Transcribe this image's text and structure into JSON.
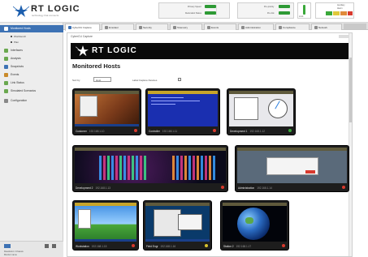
{
  "brand": {
    "name": "RT LOGIC",
    "tagline": "technology that connects"
  },
  "header": {
    "status_labels": [
      "Primary Speed",
      "Redundant Status"
    ],
    "warning_labels": [
      "Pre-priority",
      "Pre-link"
    ],
    "alarm_labels": [
      "Limit",
      "Auxiliary",
      "Alarm"
    ]
  },
  "sidebar": {
    "items": [
      {
        "label": "Monitored Hosts",
        "icon": "monitor-icon"
      },
      {
        "label": "Workbench",
        "sub": true
      },
      {
        "label": "Plan",
        "sub": true
      },
      {
        "label": "Interfaces",
        "icon": "plug-icon"
      },
      {
        "label": "Analysis",
        "icon": "chart-icon"
      },
      {
        "label": "Snapshots",
        "icon": "camera-icon"
      },
      {
        "label": "Events",
        "icon": "bell-icon"
      },
      {
        "label": "Link Status",
        "icon": "link-icon"
      },
      {
        "label": "Simulated Scenarios",
        "icon": "flask-icon"
      },
      {
        "label": "Configuration",
        "icon": "gear-icon"
      }
    ],
    "footer_text": [
      "Resolution / Chassis",
      "Monitor name"
    ]
  },
  "tabs": [
    {
      "label": "CyberCU Capture",
      "active": true
    },
    {
      "label": "Emulator"
    },
    {
      "label": "Security"
    },
    {
      "label": "Telemetry"
    },
    {
      "label": "Events"
    },
    {
      "label": "Administration"
    },
    {
      "label": "Compliance"
    },
    {
      "label": "Network"
    }
  ],
  "main": {
    "window_title": "CyberCU Capture",
    "page_title": "Monitored Hosts",
    "sort_label": "Sort by",
    "sort_value": "Host",
    "checkbox_label": "Label Capture Devices"
  },
  "hosts": [
    {
      "name": "Customer",
      "ip": "192.168.1.10",
      "status_color": "#d83a2e",
      "theme": "xp-warm"
    },
    {
      "name": "Controller",
      "ip": "192.168.1.11",
      "status_color": "#d83a2e",
      "theme": "blue-text"
    },
    {
      "name": "Development 1",
      "ip": "192.168.1.12",
      "status_color": "#3aa83a",
      "theme": "diagram"
    },
    {
      "name": "Development 2",
      "ip": "192.168.1.13",
      "status_color": "#d83a2e",
      "theme": "bars"
    },
    {
      "name": "Administration",
      "ip": "192.168.1.14",
      "status_color": "#d83a2e",
      "theme": "dialog"
    },
    {
      "name": "Workstation",
      "ip": "192.168.1.15",
      "status_color": "#d83a2e",
      "theme": "xp-bliss"
    },
    {
      "name": "Field Engr",
      "ip": "192.168.1.16",
      "status_color": "#d8c22e",
      "theme": "menus"
    },
    {
      "name": "Station 2",
      "ip": "192.168.1.17",
      "status_color": "#d83a2e",
      "theme": "globe"
    }
  ]
}
